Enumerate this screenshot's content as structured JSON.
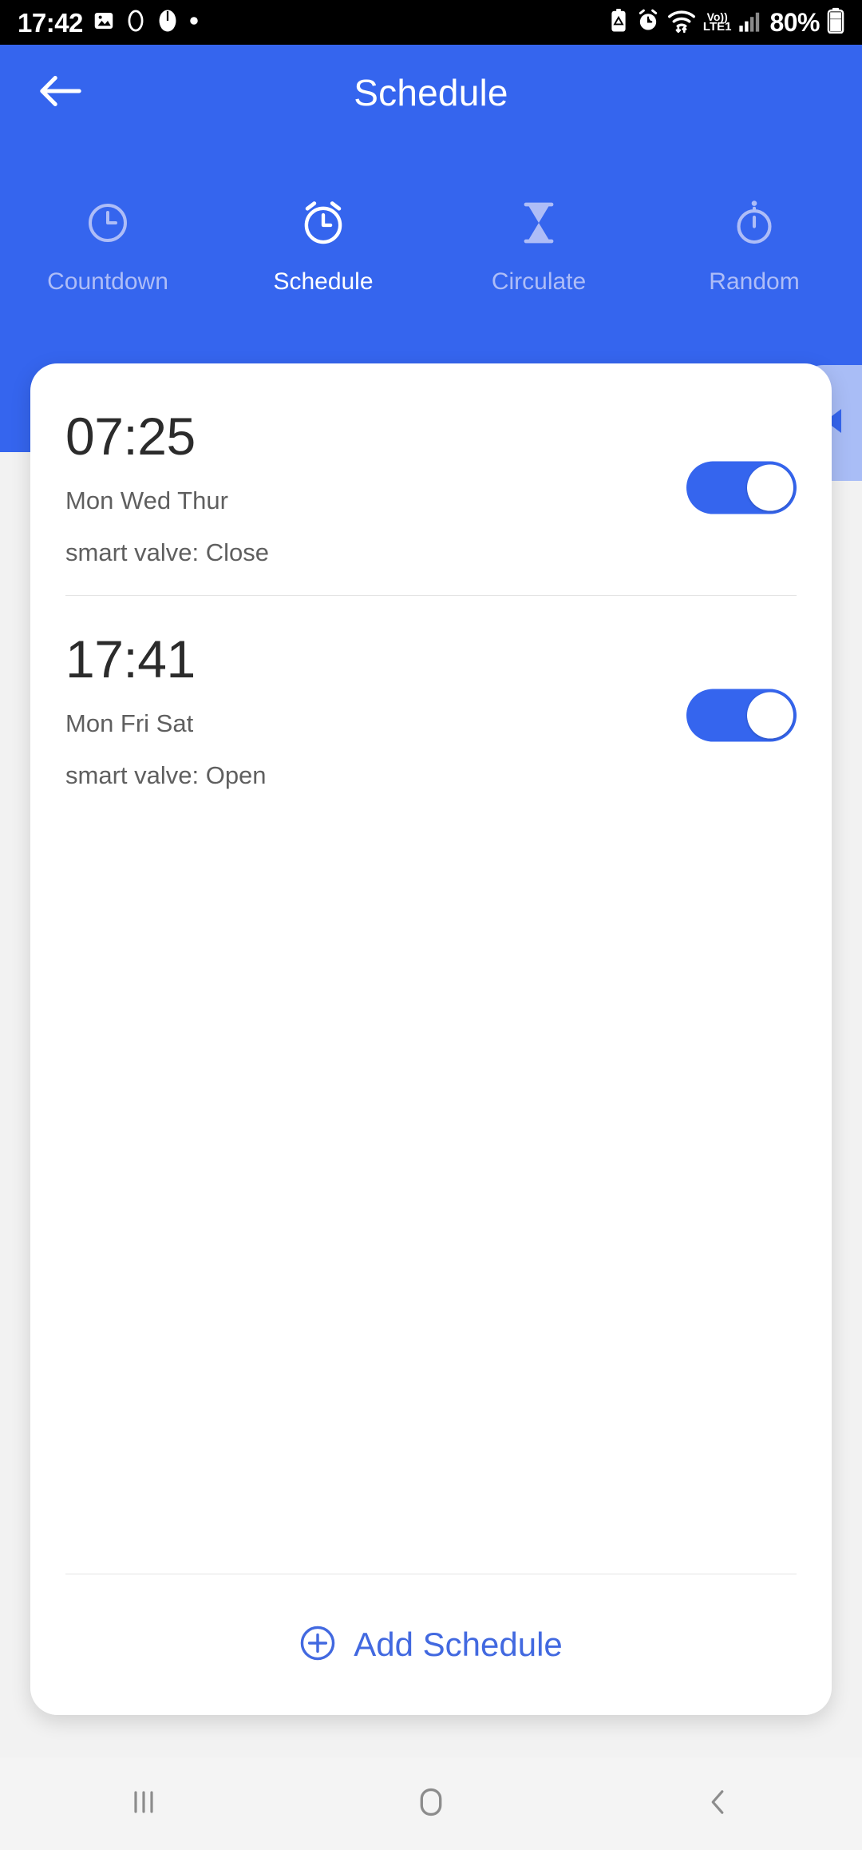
{
  "status_bar": {
    "time": "17:42",
    "left_icons": [
      "image-icon",
      "circle-outline-icon",
      "compass-icon",
      "dot-icon"
    ],
    "right_icons": [
      "battery-saver-icon",
      "alarm-icon",
      "wifi-icon",
      "volte-lte-icon",
      "signal-bars-icon"
    ],
    "volte_top": "Vo))",
    "volte_bottom": "LTE1",
    "battery_percent": "80%"
  },
  "header": {
    "title": "Schedule",
    "back_icon": "arrow-left-icon",
    "background_color": "#3565ee"
  },
  "tabs": [
    {
      "label": "Countdown",
      "icon": "clock-icon",
      "active": false
    },
    {
      "label": "Schedule",
      "icon": "alarm-clock-icon",
      "active": true
    },
    {
      "label": "Circulate",
      "icon": "hourglass-icon",
      "active": false
    },
    {
      "label": "Random",
      "icon": "stopwatch-icon",
      "active": false
    }
  ],
  "side_handle": {
    "icon": "triangle-left-icon",
    "color": "#a9bdf6"
  },
  "schedules": [
    {
      "time": "07:25",
      "days": "Mon Wed Thur",
      "action": "smart valve: Close",
      "enabled": true
    },
    {
      "time": "17:41",
      "days": "Mon Fri Sat",
      "action": "smart valve: Open",
      "enabled": true
    }
  ],
  "add_button": {
    "label": "Add Schedule",
    "icon": "plus-circle-icon",
    "color": "#4269e0"
  },
  "nav_bar": {
    "recents_icon": "recents-icon",
    "home_icon": "home-icon",
    "back_icon": "back-chevron-icon"
  }
}
